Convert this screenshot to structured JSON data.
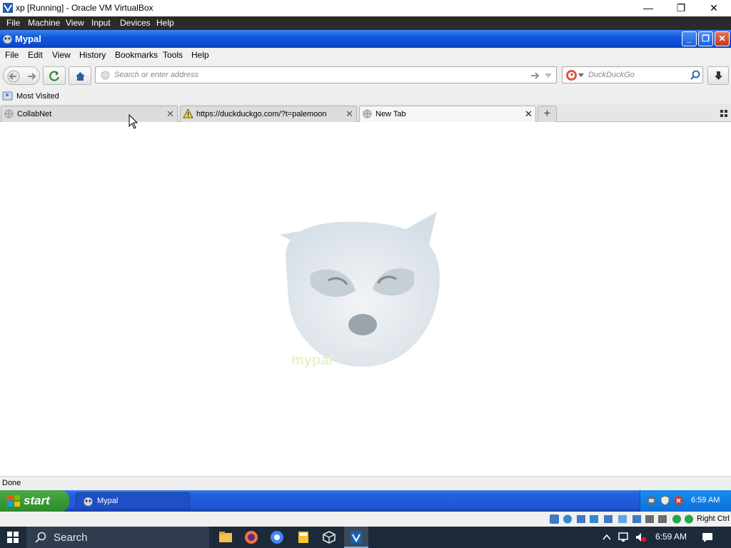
{
  "host": {
    "title": "xp [Running] - Oracle VM VirtualBox",
    "menu": [
      "File",
      "Machine",
      "View",
      "Input",
      "Devices",
      "Help"
    ],
    "status_right": "Right Ctrl"
  },
  "browser": {
    "window_title": "Mypal",
    "menu": [
      "File",
      "Edit",
      "View",
      "History",
      "Bookmarks",
      "Tools",
      "Help"
    ],
    "url_placeholder": "Search or enter address",
    "search_placeholder": "DuckDuckGo",
    "bookmarks": [
      "Most Visited"
    ],
    "tabs": [
      {
        "label": "CollabNet",
        "icon": "globe-icon",
        "active": false
      },
      {
        "label": "https://duckduckgo.com/?t=palemoon",
        "icon": "warning-icon",
        "active": false
      },
      {
        "label": "New Tab",
        "icon": "globe-icon",
        "active": true
      }
    ],
    "content_logo_text": "mypal",
    "status": "Done"
  },
  "xp_taskbar": {
    "start_label": "start",
    "task_label": "Mypal",
    "clock": "6:59 AM"
  },
  "win10_taskbar": {
    "search_label": "Search",
    "clock": "6:59 AM"
  },
  "colors": {
    "xp_title_blue": "#0a4cd0",
    "xp_start_green": "#3a9a36",
    "w10_taskbar": "#1c2a3a"
  }
}
